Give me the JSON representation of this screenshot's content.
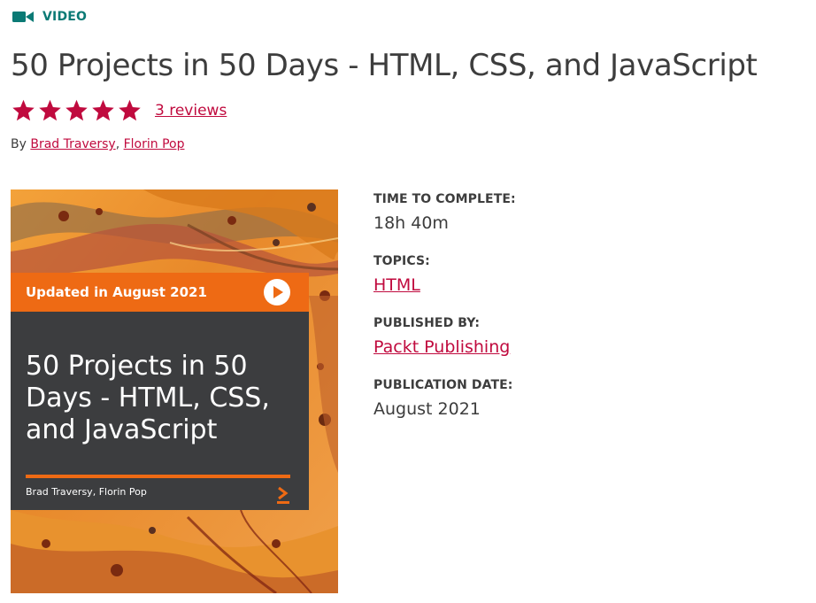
{
  "header": {
    "content_type": "VIDEO",
    "content_type_icon": "video-camera-icon",
    "accent_color": "#0b7a75"
  },
  "product": {
    "title": "50 Projects in 50 Days - HTML, CSS, and JavaScript",
    "rating": {
      "stars": 5,
      "max_stars": 5,
      "star_color": "#c00a3e",
      "reviews_label": "3 reviews"
    },
    "byline": {
      "prefix": "By ",
      "separator": ", ",
      "authors": [
        "Brad Traversy",
        "Florin Pop"
      ]
    }
  },
  "cover": {
    "banner": "Updated in August 2021",
    "title": "50 Projects in 50 Days - HTML, CSS, and JavaScript",
    "authors": "Brad Traversy, Florin Pop",
    "banner_color": "#ee6a14",
    "panel_color": "#3c3d3f"
  },
  "details": {
    "time_to_complete": {
      "label": "TIME TO COMPLETE:",
      "value": "18h 40m"
    },
    "topics": {
      "label": "TOPICS:",
      "value": "HTML"
    },
    "published_by": {
      "label": "PUBLISHED BY:",
      "value": "Packt Publishing"
    },
    "publication_date": {
      "label": "PUBLICATION DATE:",
      "value": "August 2021"
    }
  },
  "link_color": "#c00a3e"
}
